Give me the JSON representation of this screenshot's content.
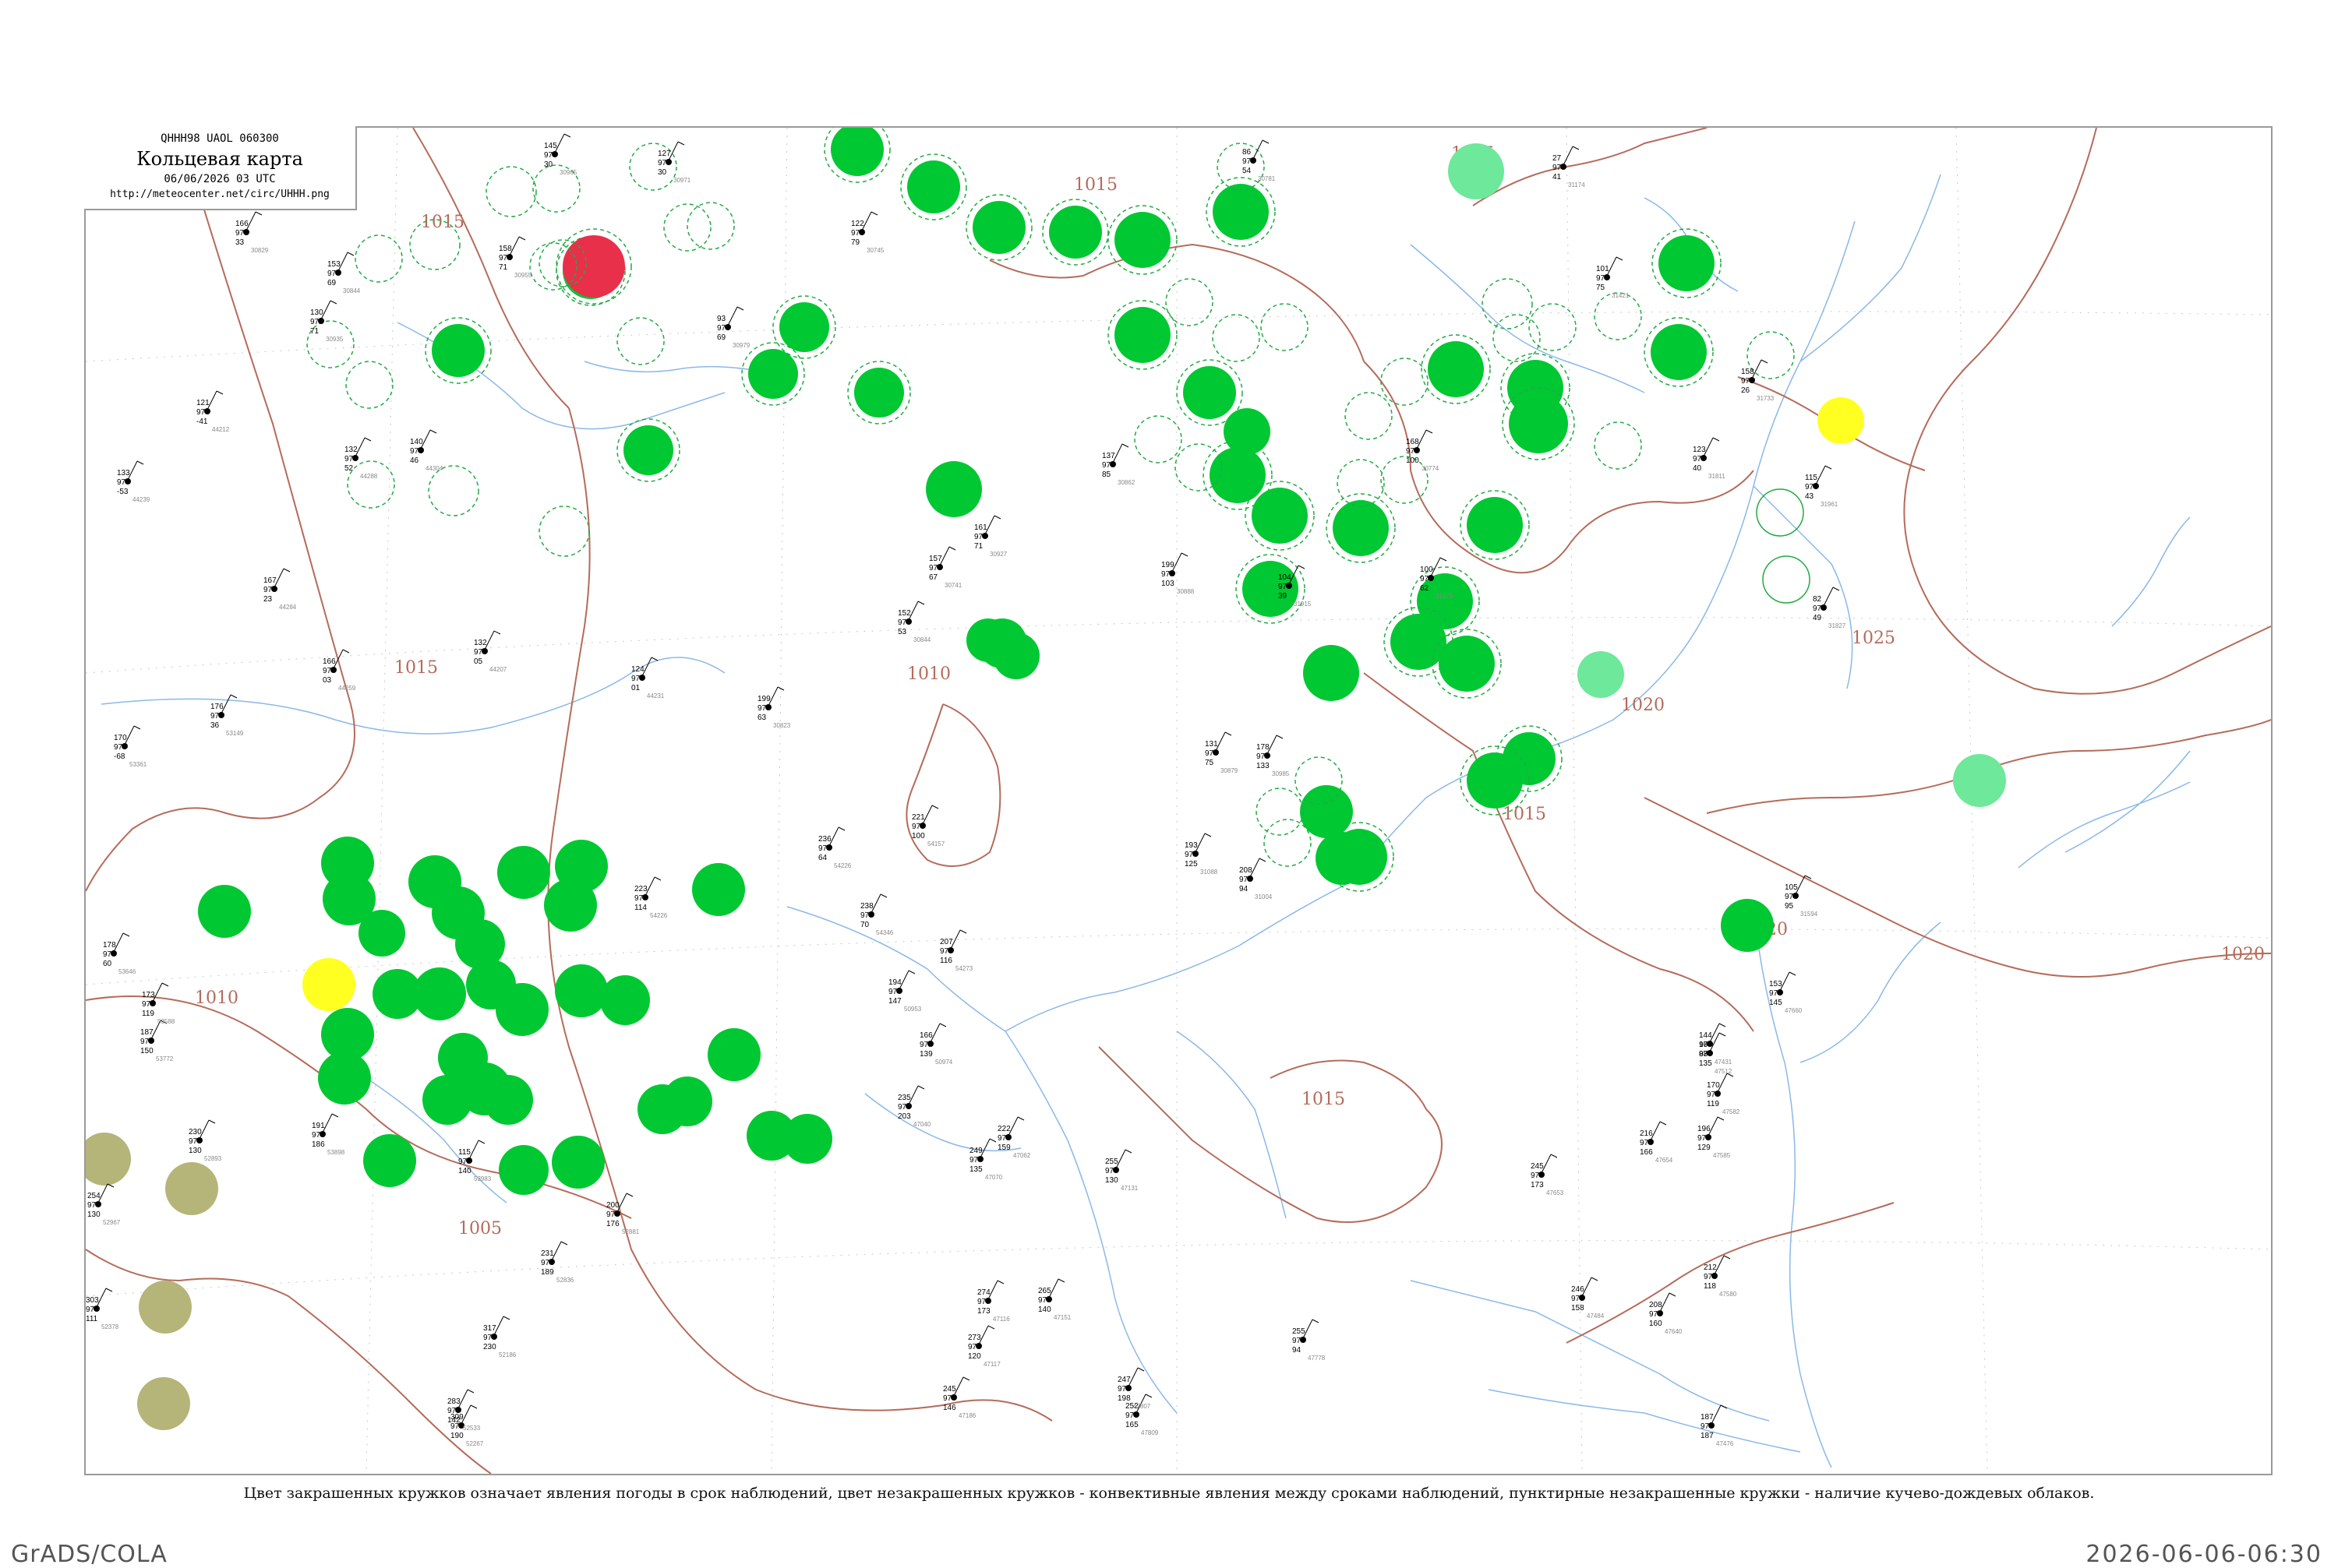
{
  "legend": {
    "code": "QHHH98  UAOL  060300",
    "title": "Кольцевая карта",
    "time": "06/06/2026 03 UTC",
    "url": "http://meteocenter.net/circ/UHHH.png"
  },
  "caption": "Цвет закрашенных кружков означает явления погоды в срок наблюдений, цвет незакрашенных кружков - конвективные явления между сроками наблюдений, пунктирные незакрашенные кружки - наличие кучево-дождевых облаков.",
  "footer": {
    "left": "GrADS/COLA",
    "right": "2026-06-06-06:30"
  },
  "colors": {
    "isobar": "#b56b5a",
    "water": "#8ab8e8",
    "rain_fill": "#00c832",
    "thunder_fill": "#e8304a",
    "shower_fill": "#ffff22",
    "haze_fill": "#b5b57a",
    "light_rain_fill": "#6ee89a",
    "cb_ring": "#22aa44"
  },
  "isobars": [
    {
      "label": "1015"
    },
    {
      "label": "1015"
    },
    {
      "label": "1015"
    },
    {
      "label": "1010"
    },
    {
      "label": "1010"
    },
    {
      "label": "1005"
    },
    {
      "label": "1015"
    },
    {
      "label": "1025"
    },
    {
      "label": "1025"
    },
    {
      "label": "1020"
    },
    {
      "label": "1020"
    },
    {
      "label": "1020"
    },
    {
      "label": "1015"
    }
  ],
  "stations": [
    {
      "t": "166",
      "d": "97",
      "v": "33",
      "id": "30829"
    },
    {
      "t": "153",
      "d": "97",
      "v": "69",
      "id": "30844"
    },
    {
      "t": "130",
      "d": "97",
      "v": "71",
      "id": "30935"
    },
    {
      "t": "121",
      "d": "97",
      "v": "-41",
      "id": "44212"
    },
    {
      "t": "133",
      "d": "97",
      "v": "-53",
      "id": "44239"
    },
    {
      "t": "132",
      "d": "97",
      "v": "52",
      "id": "44288"
    },
    {
      "t": "140",
      "d": "97",
      "v": "46",
      "id": "44304"
    },
    {
      "t": "158",
      "d": "97",
      "v": "71",
      "id": "30955"
    },
    {
      "t": "145",
      "d": "97",
      "v": "30",
      "id": "30965"
    },
    {
      "t": "127",
      "d": "97",
      "v": "30",
      "id": "30971"
    },
    {
      "t": "93",
      "d": "97",
      "v": "69",
      "id": "30979"
    },
    {
      "t": "122",
      "d": "97",
      "v": "79",
      "id": "30745"
    },
    {
      "t": "86",
      "d": "97",
      "v": "54",
      "id": "30781"
    },
    {
      "t": "27",
      "d": "97",
      "v": "41",
      "id": "31174"
    },
    {
      "t": "101",
      "d": "97",
      "v": "75",
      "id": "31421"
    },
    {
      "t": "137",
      "d": "97",
      "v": "85",
      "id": "30862"
    },
    {
      "t": "161",
      "d": "97",
      "v": "71",
      "id": "30927"
    },
    {
      "t": "157",
      "d": "97",
      "v": "67",
      "id": "30741"
    },
    {
      "t": "152",
      "d": "97",
      "v": "53",
      "id": "30844"
    },
    {
      "t": "199",
      "d": "97",
      "v": "63",
      "id": "30823"
    },
    {
      "t": "124",
      "d": "97",
      "v": "01",
      "id": "44231"
    },
    {
      "t": "132",
      "d": "97",
      "v": "05",
      "id": "44207"
    },
    {
      "t": "167",
      "d": "97",
      "v": "23",
      "id": "44284"
    },
    {
      "t": "166",
      "d": "97",
      "v": "03",
      "id": "44259"
    },
    {
      "t": "176",
      "d": "97",
      "v": "36",
      "id": "53149"
    },
    {
      "t": "170",
      "d": "97",
      "v": "-68",
      "id": "53361"
    },
    {
      "t": "178",
      "d": "97",
      "v": "60",
      "id": "53646"
    },
    {
      "t": "187",
      "d": "97",
      "v": "150",
      "id": "53772"
    },
    {
      "t": "173",
      "d": "97",
      "v": "119",
      "id": "53588"
    },
    {
      "t": "254",
      "d": "97",
      "v": "130",
      "id": "52967"
    },
    {
      "t": "303",
      "d": "97",
      "v": "111",
      "id": "52378"
    },
    {
      "t": "230",
      "d": "97",
      "v": "130",
      "id": "52893"
    },
    {
      "t": "191",
      "d": "97",
      "v": "186",
      "id": "53898"
    },
    {
      "t": "115",
      "d": "97",
      "v": "140",
      "id": "53983"
    },
    {
      "t": "231",
      "d": "97",
      "v": "189",
      "id": "52836"
    },
    {
      "t": "200",
      "d": "97",
      "v": "176",
      "id": "52881"
    },
    {
      "t": "317",
      "d": "97",
      "v": "230",
      "id": "52186"
    },
    {
      "t": "309",
      "d": "97",
      "v": "190",
      "id": "52267"
    },
    {
      "t": "245",
      "d": "97",
      "v": "146",
      "id": "47186"
    },
    {
      "t": "283",
      "d": "97",
      "v": "142",
      "id": "52533"
    },
    {
      "t": "223",
      "d": "97",
      "v": "114",
      "id": "54226"
    },
    {
      "t": "238",
      "d": "97",
      "v": "70",
      "id": "54346"
    },
    {
      "t": "236",
      "d": "97",
      "v": "64",
      "id": "54226"
    },
    {
      "t": "221",
      "d": "97",
      "v": "100",
      "id": "54157"
    },
    {
      "t": "207",
      "d": "97",
      "v": "116",
      "id": "54273"
    },
    {
      "t": "194",
      "d": "97",
      "v": "147",
      "id": "50953"
    },
    {
      "t": "166",
      "d": "97",
      "v": "139",
      "id": "50974"
    },
    {
      "t": "235",
      "d": "97",
      "v": "203",
      "id": "47040"
    },
    {
      "t": "249",
      "d": "97",
      "v": "135",
      "id": "47070"
    },
    {
      "t": "274",
      "d": "97",
      "v": "173",
      "id": "47116"
    },
    {
      "t": "273",
      "d": "97",
      "v": "120",
      "id": "47117"
    },
    {
      "t": "265",
      "d": "97",
      "v": "140",
      "id": "47151"
    },
    {
      "t": "255",
      "d": "97",
      "v": "130",
      "id": "47131"
    },
    {
      "t": "222",
      "d": "97",
      "v": "159",
      "id": "47062"
    },
    {
      "t": "252",
      "d": "97",
      "v": "165",
      "id": "47809"
    },
    {
      "t": "247",
      "d": "97",
      "v": "198",
      "id": "47807"
    },
    {
      "t": "255",
      "d": "97",
      "v": "94",
      "id": "47778"
    },
    {
      "t": "216",
      "d": "97",
      "v": "166",
      "id": "47654"
    },
    {
      "t": "245",
      "d": "97",
      "v": "173",
      "id": "47653"
    },
    {
      "t": "246",
      "d": "97",
      "v": "158",
      "id": "47484"
    },
    {
      "t": "208",
      "d": "97",
      "v": "160",
      "id": "47640"
    },
    {
      "t": "187",
      "d": "97",
      "v": "187",
      "id": "47476"
    },
    {
      "t": "212",
      "d": "97",
      "v": "118",
      "id": "47580"
    },
    {
      "t": "196",
      "d": "97",
      "v": "129",
      "id": "47585"
    },
    {
      "t": "170",
      "d": "97",
      "v": "119",
      "id": "47582"
    },
    {
      "t": "164",
      "d": "97",
      "v": "135",
      "id": "47512"
    },
    {
      "t": "153",
      "d": "97",
      "v": "145",
      "id": "47660"
    },
    {
      "t": "144",
      "d": "97",
      "v": "88",
      "id": "47431"
    },
    {
      "t": "105",
      "d": "97",
      "v": "95",
      "id": "31594"
    },
    {
      "t": "104",
      "d": "97",
      "v": "39",
      "id": "31915"
    },
    {
      "t": "82",
      "d": "97",
      "v": "49",
      "id": "31827"
    },
    {
      "t": "115",
      "d": "97",
      "v": "43",
      "id": "31961"
    },
    {
      "t": "158",
      "d": "97",
      "v": "26",
      "id": "31733"
    },
    {
      "t": "123",
      "d": "97",
      "v": "40",
      "id": "31811"
    },
    {
      "t": "100",
      "d": "97",
      "v": "62",
      "id": "31679"
    },
    {
      "t": "168",
      "d": "97",
      "v": "100",
      "id": "30774"
    },
    {
      "t": "199",
      "d": "97",
      "v": "103",
      "id": "30888"
    },
    {
      "t": "131",
      "d": "97",
      "v": "75",
      "id": "30879"
    },
    {
      "t": "178",
      "d": "97",
      "v": "133",
      "id": "30985"
    },
    {
      "t": "208",
      "d": "97",
      "v": "94",
      "id": "31004"
    },
    {
      "t": "193",
      "d": "97",
      "v": "125",
      "id": "31088"
    }
  ]
}
